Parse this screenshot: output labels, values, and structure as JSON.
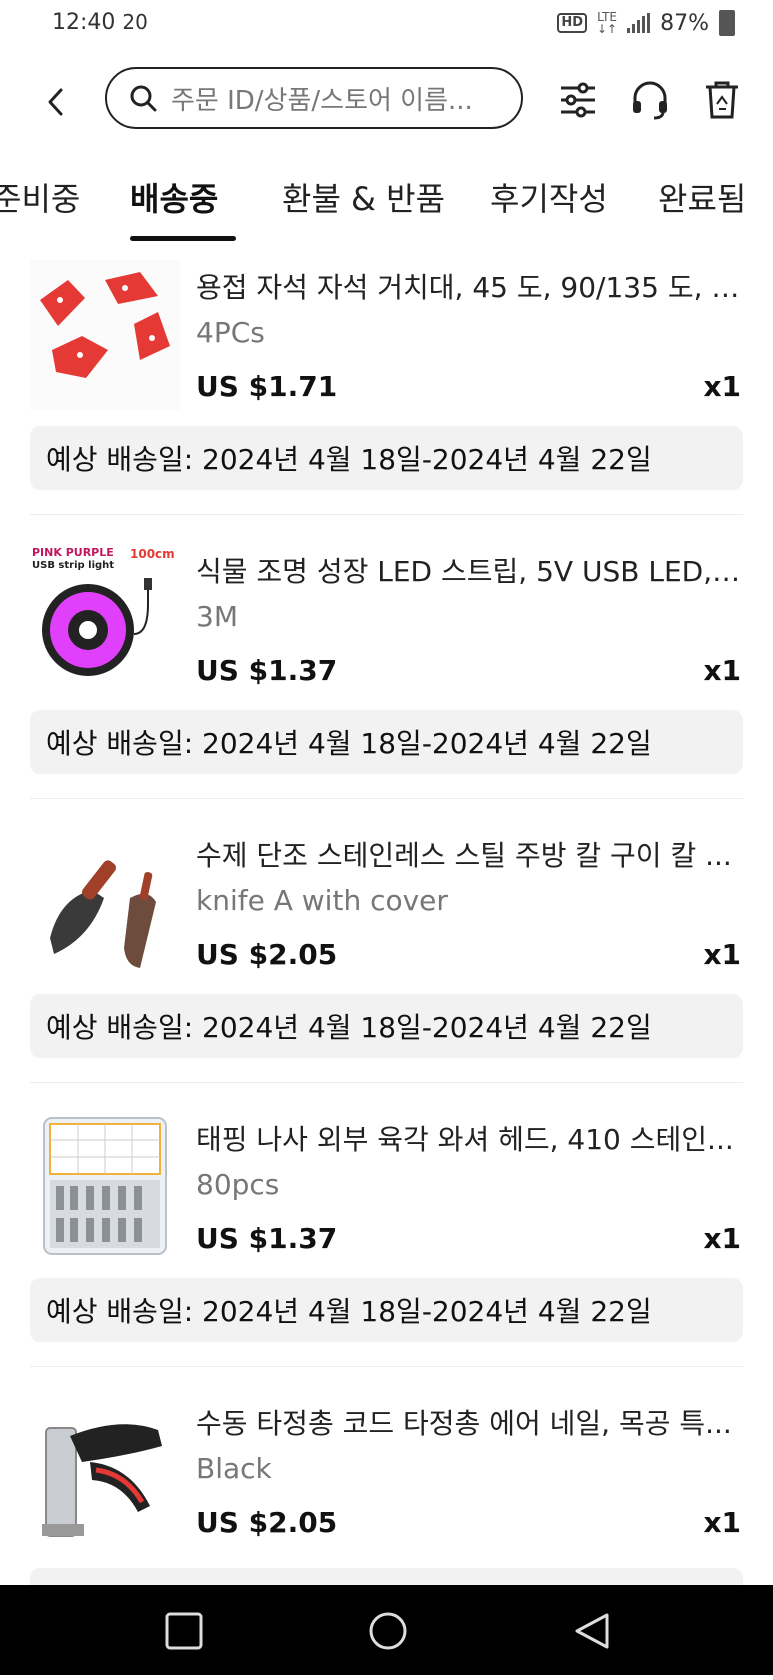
{
  "status": {
    "time": "12:40",
    "time_sup": "20",
    "hd": "HD",
    "lte": "LTE",
    "battery": "87%"
  },
  "header": {
    "search_placeholder": "주문 ID/상품/스토어 이름...",
    "icons": [
      "back-icon",
      "search-icon",
      "filter-icon",
      "headset-icon",
      "trash-icon"
    ]
  },
  "tabs": [
    {
      "label": "준비중"
    },
    {
      "label": "배송중",
      "active": true
    },
    {
      "label": "환불 & 반품"
    },
    {
      "label": "후기작성"
    },
    {
      "label": "완료됨"
    }
  ],
  "orders": [
    {
      "title": "용접 자석 자석 거치대, 45 도, 90/135 도, 9...",
      "variant": "4PCs",
      "price": "US $1.71",
      "qty": "x1",
      "delivery": "예상 배송일: 2024년 4월 18일-2024년 4월 22일"
    },
    {
      "title": "식물 조명 성장 LED 스트립, 5V USB LED, 1...",
      "variant": "3M",
      "price": "US $1.37",
      "qty": "x1",
      "delivery": "예상 배송일: 2024년 4월 18일-2024년 4월 22일",
      "thumb_text": {
        "line1": "PINK PURPLE",
        "line2": "USB strip light",
        "size": "100cm"
      }
    },
    {
      "title": "수제 단조 스테인레스 스틸 주방 칼 구이 칼 ...",
      "variant": "knife A with cover",
      "price": "US $2.05",
      "qty": "x1",
      "delivery": "예상 배송일: 2024년 4월 18일-2024년 4월 22일"
    },
    {
      "title": "태핑 나사 외부 육각 와셔 헤드, 410 스테인...",
      "variant": "80pcs",
      "price": "US $1.37",
      "qty": "x1",
      "delivery": "예상 배송일: 2024년 4월 18일-2024년 4월 22일"
    },
    {
      "title": "수동 타정총 코드 타정총 에어 네일, 목공 특...",
      "variant": "Black",
      "price": "US $2.05",
      "qty": "x1"
    }
  ],
  "colors": {
    "accent": "#111111",
    "delivery_bg": "#f2f2f2",
    "muted": "#777777"
  }
}
